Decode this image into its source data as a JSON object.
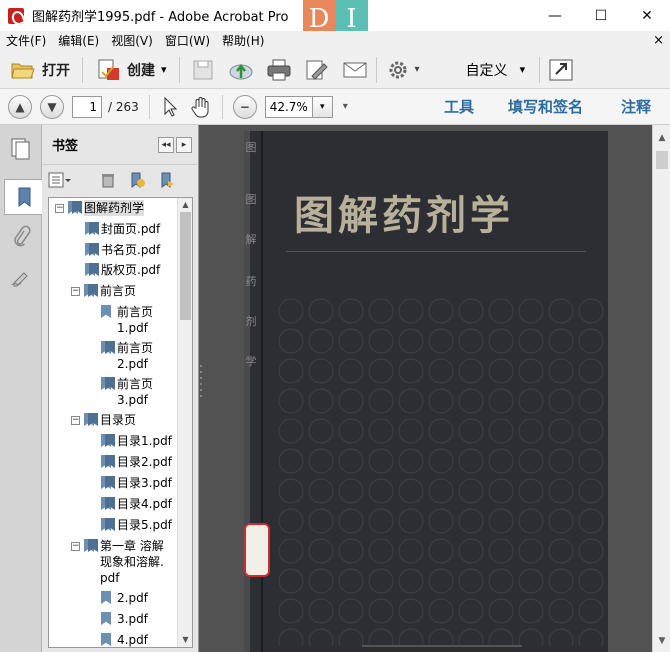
{
  "window": {
    "title": "图解药剂学1995.pdf - Adobe Acrobat Pro",
    "logo_left": "D",
    "logo_right": "I",
    "minimize": "—",
    "maximize": "☐",
    "close": "✕"
  },
  "menubar": {
    "items": [
      "文件(F)",
      "编辑(E)",
      "视图(V)",
      "窗口(W)",
      "帮助(H)"
    ],
    "close": "×"
  },
  "toolbar": {
    "open_label": "打开",
    "create_label": "创建",
    "create_arrow": "▾",
    "customize_label": "自定义",
    "customize_arrow": "▾"
  },
  "navigation": {
    "current_page": "1",
    "total_pages": "/ 263",
    "zoom": "42.7%",
    "zoom_arrow": "▾",
    "tools_label": "工具",
    "fill_sign_label": "填写和签名",
    "comment_label": "注释"
  },
  "bookmarks": {
    "header": "书签",
    "collapse_btn": "◂◂",
    "expand_btn": "▸",
    "items": [
      {
        "label": "图解药剂学",
        "toggle": "−",
        "folder": true
      },
      {
        "label": "封面页.pdf"
      },
      {
        "label": "书名页.pdf"
      },
      {
        "label": "版权页.pdf"
      },
      {
        "label": "前言页",
        "toggle": "−",
        "folder": true
      },
      {
        "label": "前言页\n1.pdf"
      },
      {
        "label": "前言页\n2.pdf"
      },
      {
        "label": "前言页\n3.pdf"
      },
      {
        "label": "目录页",
        "toggle": "−",
        "folder": true
      },
      {
        "label": "目录1.pdf"
      },
      {
        "label": "目录2.pdf"
      },
      {
        "label": "目录3.pdf"
      },
      {
        "label": "目录4.pdf"
      },
      {
        "label": "目录5.pdf"
      },
      {
        "label": "第一章 溶解\n现象和溶解.\npdf",
        "toggle": "−",
        "folder": true
      },
      {
        "label": "2.pdf"
      },
      {
        "label": "3.pdf"
      },
      {
        "label": "4.pdf"
      }
    ]
  },
  "document": {
    "cover_title": "图解药剂学",
    "spine_chars": [
      "图",
      "解",
      "药",
      "剂",
      "学"
    ]
  }
}
